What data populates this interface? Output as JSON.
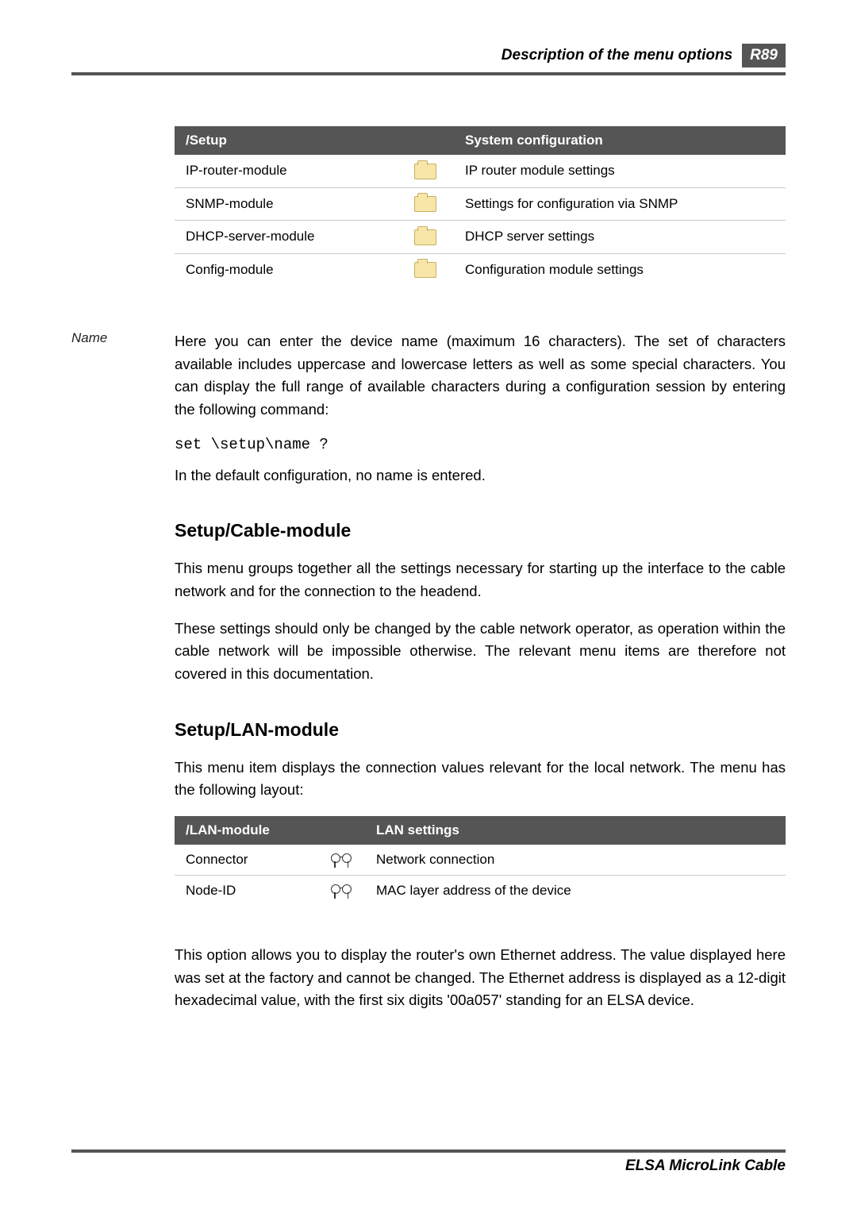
{
  "header": {
    "title": "Description of the menu options",
    "page_label": "R89"
  },
  "setup_table": {
    "col1": "/Setup",
    "col2": "System configuration",
    "rows": [
      {
        "name": "IP-router-module",
        "desc": "IP router module settings"
      },
      {
        "name": "SNMP-module",
        "desc": "Settings for configuration via SNMP"
      },
      {
        "name": "DHCP-server-module",
        "desc": "DHCP server settings"
      },
      {
        "name": "Config-module",
        "desc": "Configuration module settings"
      }
    ]
  },
  "name_section": {
    "margin_label": "Name",
    "para1": "Here you can enter the device name (maximum 16 characters).  The set of characters available includes uppercase and lowercase letters as well as some special characters.  You can display the full range of available characters during a configuration session by entering the following command:",
    "code": "set \\setup\\name ?",
    "para2": "In the default configuration, no name is entered."
  },
  "cable_section": {
    "heading": "Setup/Cable-module",
    "para1": "This menu groups together all the settings necessary for starting up the interface to the cable network and for the connection to the headend.",
    "para2": "These settings should only be changed by the cable network operator, as operation within the cable network will be impossible otherwise.  The relevant menu items are therefore not covered in this documentation."
  },
  "lan_section": {
    "heading": "Setup/LAN-module",
    "para1": "This menu item displays the connection values relevant for the local network. The menu has the following layout:"
  },
  "lan_table": {
    "col1": "/LAN-module",
    "col2": "LAN settings",
    "rows": [
      {
        "name": "Connector",
        "desc": "Network connection"
      },
      {
        "name": "Node-ID",
        "desc": "MAC layer address of the device"
      }
    ]
  },
  "node_id_section": {
    "para": "This option allows you to display the router's own Ethernet address.  The value displayed here was set at the factory and cannot be changed.  The Ethernet address is displayed as a 12-digit hexadecimal value, with the first six digits '00a057' standing for an ELSA device."
  },
  "footer": {
    "text": "ELSA MicroLink Cable"
  }
}
